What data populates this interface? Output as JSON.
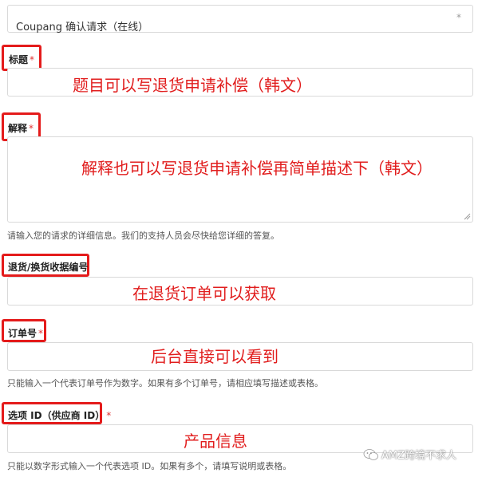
{
  "request_type": {
    "value": "Coupang 确认请求（在线）",
    "required_mark": "*"
  },
  "title_field": {
    "label": "标题",
    "required_mark": "*",
    "annotation": "题目可以写退货申请补偿（韩文）"
  },
  "description_field": {
    "label": "解释",
    "required_mark": "*",
    "annotation": "解释也可以写退货申请补偿再简单描述下（韩文）",
    "help": "请输入您的请求的详细信息。我们的支持人员会尽快给您详细的答复。"
  },
  "return_number_field": {
    "label": "退货/换货收据编号",
    "annotation": "在退货订单可以获取"
  },
  "order_number_field": {
    "label": "订单号",
    "required_mark": "*",
    "annotation": "后台直接可以看到",
    "help": "只能输入一个代表订单号作为数字。如果有多个订单号，请相应填写描述或表格。"
  },
  "option_id_field": {
    "label": "选项 ID（供应商 ID）",
    "required_mark": "*",
    "annotation": "产品信息",
    "help": "只能以数字形式输入一个代表选项 ID。如果有多个，请填写说明或表格。"
  },
  "watermark": {
    "text": "AMZ跨境不求人",
    "icon": "wechat-icon"
  },
  "colors": {
    "annotation_red": "#e41b1b",
    "required_red": "#e03030",
    "border_gray": "#d9d9d9"
  }
}
